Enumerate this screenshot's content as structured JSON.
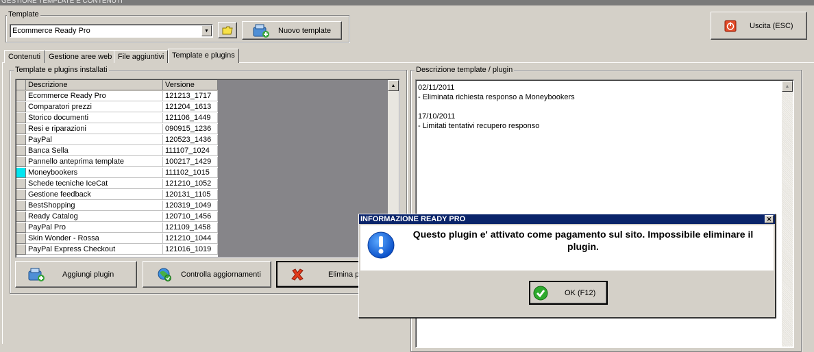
{
  "window": {
    "title": "GESTIONE TEMPLATE E CONTENUTI"
  },
  "template_group": {
    "legend": "Template",
    "selected": "Ecommerce Ready Pro",
    "new_button": "Nuovo template"
  },
  "exit_button": "Uscita (ESC)",
  "tabs": [
    {
      "label": "Contenuti",
      "active": false
    },
    {
      "label": "Gestione aree web",
      "active": false
    },
    {
      "label": "File aggiuntivi",
      "active": false
    },
    {
      "label": "Template e plugins",
      "active": true
    }
  ],
  "installed": {
    "legend": "Template e plugins installati",
    "columns": [
      "Descrizione",
      "Versione"
    ],
    "rows": [
      {
        "desc": "Ecommerce Ready Pro",
        "ver": "121213_1717"
      },
      {
        "desc": "Comparatori prezzi",
        "ver": "121204_1613"
      },
      {
        "desc": "Storico documenti",
        "ver": "121106_1449"
      },
      {
        "desc": "Resi e riparazioni",
        "ver": "090915_1236"
      },
      {
        "desc": "PayPal",
        "ver": "120523_1436"
      },
      {
        "desc": "Banca Sella",
        "ver": "111107_1024"
      },
      {
        "desc": "Pannello anteprima template",
        "ver": "100217_1429"
      },
      {
        "desc": "Moneybookers",
        "ver": "111102_1015"
      },
      {
        "desc": "Schede tecniche IceCat",
        "ver": "121210_1052"
      },
      {
        "desc": "Gestione feedback",
        "ver": "120131_1105"
      },
      {
        "desc": "BestShopping",
        "ver": "120319_1049"
      },
      {
        "desc": "Ready Catalog",
        "ver": "120710_1456"
      },
      {
        "desc": "PayPal Pro",
        "ver": "121109_1458"
      },
      {
        "desc": "Skin Wonder - Rossa",
        "ver": "121210_1044"
      },
      {
        "desc": "PayPal Express Checkout",
        "ver": "121016_1019"
      }
    ],
    "selected_index": 7,
    "buttons": {
      "add": "Aggiungi plugin",
      "check": "Controlla aggiornamenti",
      "delete": "Elimina pl"
    }
  },
  "description": {
    "legend": "Descrizione template / plugin",
    "lines": [
      "02/11/2011",
      "- Eliminata richiesta responso a Moneybookers",
      "",
      "17/10/2011",
      "- Limitati tentativi recupero responso"
    ]
  },
  "dialog": {
    "title": "INFORMAZIONE READY PRO",
    "message": "Questo plugin e' attivato come pagamento sul sito. Impossibile eliminare il plugin.",
    "ok_button": "OK (F12)",
    "close_glyph": "✕"
  },
  "colors": {
    "face": "#d4d0c8",
    "dark_panel": "#868589",
    "dialog_title": "#0a246a",
    "selection_marker": "#00e5f0"
  }
}
